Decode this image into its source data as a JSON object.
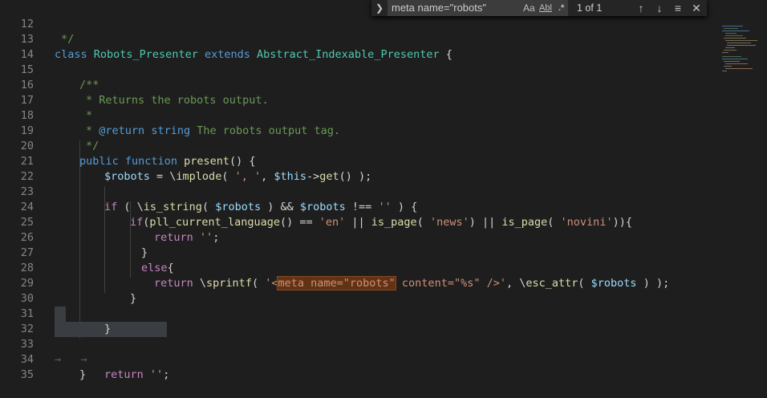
{
  "find": {
    "query": "meta name=\"robots\"",
    "match_case": "Aa",
    "whole_word": "Abl",
    "regex": ".*",
    "count": "1 of 1",
    "toggle_icon": "chevron-right-icon",
    "prev_icon": "arrow-up-icon",
    "next_icon": "arrow-down-icon",
    "selection_icon": "lines-icon",
    "close_icon": "close-icon"
  },
  "lines": [
    {
      "n": "12"
    },
    {
      "n": "13"
    },
    {
      "n": "14"
    },
    {
      "n": "15"
    },
    {
      "n": "16"
    },
    {
      "n": "17"
    },
    {
      "n": "18"
    },
    {
      "n": "19"
    },
    {
      "n": "20"
    },
    {
      "n": "21"
    },
    {
      "n": "22"
    },
    {
      "n": "23"
    },
    {
      "n": "24"
    },
    {
      "n": "25"
    },
    {
      "n": "26"
    },
    {
      "n": "27"
    },
    {
      "n": "28"
    },
    {
      "n": "29"
    },
    {
      "n": "30"
    },
    {
      "n": "31"
    },
    {
      "n": "32"
    },
    {
      "n": "33"
    },
    {
      "n": "34"
    },
    {
      "n": "35"
    }
  ],
  "code": {
    "l12": "*/",
    "l13_class": "class",
    "l13_name": "Robots_Presenter",
    "l13_extends": "extends",
    "l13_parent": "Abstract_Indexable_Presenter",
    "l13_brace": " {",
    "l15": "/**",
    "l16": "* Returns the robots output.",
    "l17": "*",
    "l18_star": "* ",
    "l18_tag": "@return",
    "l18_type": "string",
    "l18_rest": " The robots output tag.",
    "l19": "*/",
    "l20_public": "public",
    "l20_function": "function",
    "l20_name": "present",
    "l20_rest": "() {",
    "l21_var": "$robots",
    "l21_eq": " = \\",
    "l21_fn": "implode",
    "l21_open": "( ",
    "l21_str": "', '",
    "l21_comma": ", ",
    "l21_this": "$this",
    "l21_arrow": "->",
    "l21_get": "get",
    "l21_end": "() );",
    "l23_if": "if",
    "l23_a": " ( \\",
    "l23_fn": "is_string",
    "l23_b": "( ",
    "l23_var1": "$robots",
    "l23_c": " ) && ",
    "l23_var2": "$robots",
    "l23_d": " !== ",
    "l23_str": "''",
    "l23_e": " ) {",
    "l24_if": "if",
    "l24_a": "(",
    "l24_fn1": "pll_current_language",
    "l24_b": "() == ",
    "l24_s1": "'en'",
    "l24_c": " || ",
    "l24_fn2": "is_page",
    "l24_d": "( ",
    "l24_s2": "'news'",
    "l24_e": ") || ",
    "l24_fn3": "is_page",
    "l24_f": "( ",
    "l24_s3": "'novini'",
    "l24_g": ")){",
    "l25_ret": "return",
    "l25_str": "''",
    "l25_end": ";",
    "l26": "}",
    "l27_else": "else",
    "l27_brace": "{",
    "l28_ret": "return",
    "l28_a": " \\",
    "l28_fn": "sprintf",
    "l28_b": "( ",
    "l28_s1": "'<",
    "l28_match": "meta name=\"robots\"",
    "l28_s2": " content=\"%s\" />'",
    "l28_c": ", \\",
    "l28_fn2": "esc_attr",
    "l28_d": "( ",
    "l28_var": "$robots",
    "l28_e": " ) );",
    "l29": "}",
    "l31": "}",
    "l33_arrows": "→   →   ",
    "l33_ret": "return",
    "l33_str": "''",
    "l33_end": ";",
    "l34": "}"
  }
}
